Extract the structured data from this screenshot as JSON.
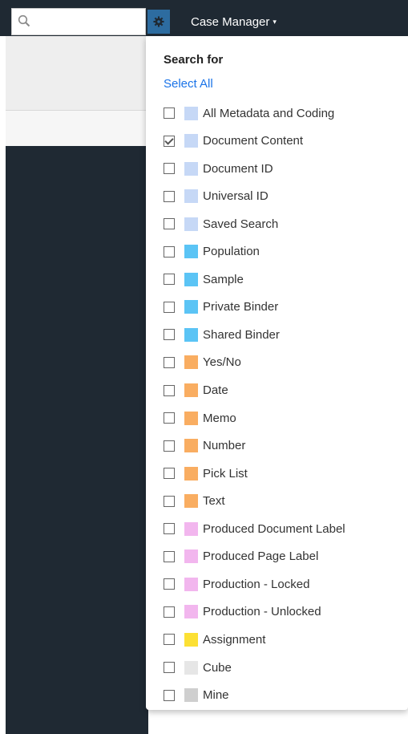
{
  "topbar": {
    "search_placeholder": "",
    "case_manager_label": "Case Manager",
    "caret": "▾",
    "colors": {
      "bar": "#1f2933",
      "gear_button": "#2d6ca0"
    },
    "icons": {
      "search": "search-icon",
      "gear": "gear-icon"
    }
  },
  "dropdown": {
    "heading": "Search for",
    "select_all": "Select All",
    "options": [
      {
        "label": "All Metadata and Coding",
        "checked": false,
        "color": "#c6d8f6"
      },
      {
        "label": "Document Content",
        "checked": true,
        "color": "#c6d8f6"
      },
      {
        "label": "Document ID",
        "checked": false,
        "color": "#c6d8f6"
      },
      {
        "label": "Universal ID",
        "checked": false,
        "color": "#c6d8f6"
      },
      {
        "label": "Saved Search",
        "checked": false,
        "color": "#c6d8f6"
      },
      {
        "label": "Population",
        "checked": false,
        "color": "#5bc4f5"
      },
      {
        "label": "Sample",
        "checked": false,
        "color": "#5bc4f5"
      },
      {
        "label": "Private Binder",
        "checked": false,
        "color": "#5bc4f5"
      },
      {
        "label": "Shared Binder",
        "checked": false,
        "color": "#5bc4f5"
      },
      {
        "label": "Yes/No",
        "checked": false,
        "color": "#f9ad61"
      },
      {
        "label": "Date",
        "checked": false,
        "color": "#f9ad61"
      },
      {
        "label": "Memo",
        "checked": false,
        "color": "#f9ad61"
      },
      {
        "label": "Number",
        "checked": false,
        "color": "#f9ad61"
      },
      {
        "label": "Pick List",
        "checked": false,
        "color": "#f9ad61"
      },
      {
        "label": "Text",
        "checked": false,
        "color": "#f9ad61"
      },
      {
        "label": "Produced Document Label",
        "checked": false,
        "color": "#f2b6ee"
      },
      {
        "label": "Produced Page Label",
        "checked": false,
        "color": "#f2b6ee"
      },
      {
        "label": "Production - Locked",
        "checked": false,
        "color": "#f2b6ee"
      },
      {
        "label": "Production - Unlocked",
        "checked": false,
        "color": "#f2b6ee"
      },
      {
        "label": "Assignment",
        "checked": false,
        "color": "#fce034"
      },
      {
        "label": "Cube",
        "checked": false,
        "color": "#e6e6e6"
      },
      {
        "label": "Mine",
        "checked": false,
        "color": "#cfcfcf"
      }
    ]
  }
}
